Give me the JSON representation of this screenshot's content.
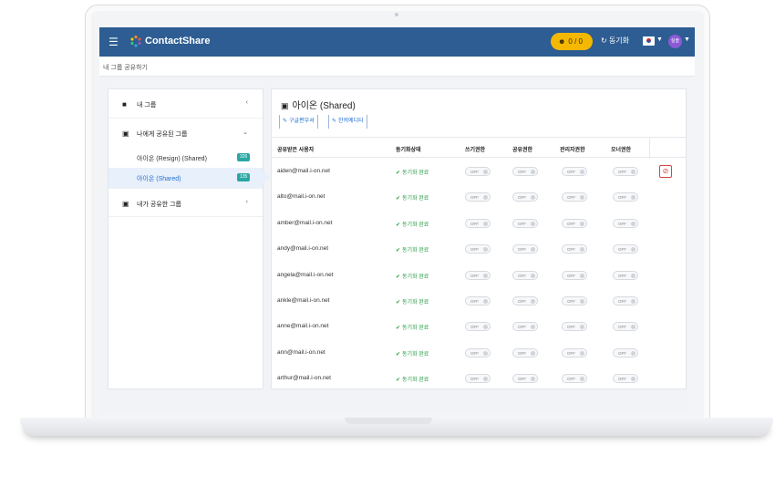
{
  "navbar": {
    "menu_icon": "hamburger-icon",
    "brand": "ContactShare",
    "counter": "0 / 0",
    "sync_label": "동기화",
    "avatar_text": "실솔"
  },
  "breadcrumb": "내 그룹 공유하기",
  "sidebar": {
    "items": [
      {
        "label": "내 그룹",
        "icon": "folder-icon"
      },
      {
        "label": "나에게 공유된 그룹",
        "icon": "share-icon"
      },
      {
        "label": "내가 공유한 그룹",
        "icon": "share-out-icon"
      }
    ],
    "sub_items": [
      {
        "label": "아이온 (Resign) (Shared)",
        "badge": "326"
      },
      {
        "label": "아이온 (Shared)",
        "badge": "135"
      }
    ]
  },
  "panel": {
    "title": "아이온 (Shared)",
    "buttons": [
      "구글편부셔",
      "한켜예디터"
    ],
    "columns": [
      "공유받은 사용자",
      "동기화상태",
      "쓰기권한",
      "공유권한",
      "관리자권한",
      "오너권한"
    ],
    "toggle_label": "OFF",
    "rows": [
      {
        "email": "aiden@mail.i-on.net",
        "status": "동기화 완료"
      },
      {
        "email": "alto@mail.i-on.net",
        "status": "동기화 완료"
      },
      {
        "email": "amber@mail.i-on.net",
        "status": "동기화 완료"
      },
      {
        "email": "andy@mail.i-on.net",
        "status": "동기화 완료"
      },
      {
        "email": "angela@mail.i-on.net",
        "status": "동기화 완료"
      },
      {
        "email": "ankle@mail.i-on.net",
        "status": "동기화 완료"
      },
      {
        "email": "anne@mail.i-on.net",
        "status": "동기화 완료"
      },
      {
        "email": "ann@mail.i-on.net",
        "status": "동기화 완료"
      },
      {
        "email": "arthur@mail.i-on.net",
        "status": "동기화 완료"
      }
    ]
  },
  "colors": {
    "navbar": "#2d5d92",
    "counter": "#f5b800",
    "badge": "#2aa7a4",
    "success": "#2a9d48",
    "danger": "#d64545"
  }
}
